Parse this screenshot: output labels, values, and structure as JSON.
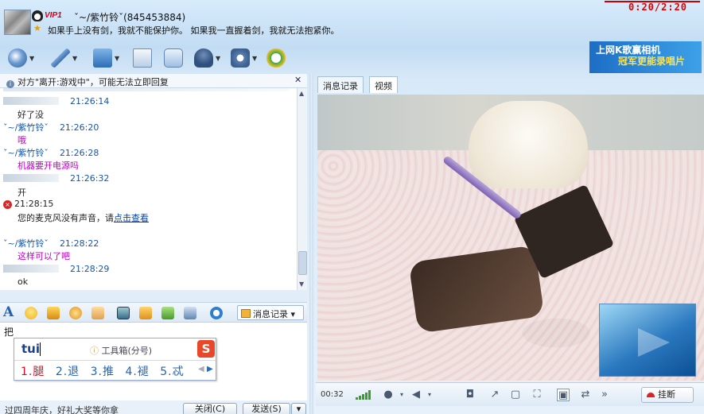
{
  "window": {
    "clock": "0:20/2:20",
    "contact_nick": "ˇ~/紫竹铃ˇ",
    "contact_id": "(845453884)",
    "vip_label": "VIP1",
    "status_message": "如果手上没有剑，我就不能保护你。 如果我一直握着剑，我就无法抱紧你。"
  },
  "toolbar": {
    "icons": [
      "video-call-icon",
      "voice-call-icon",
      "send-file-icon",
      "send-mail-icon",
      "app-icon",
      "remote-assist-icon",
      "settings-icon",
      "soso-icon"
    ]
  },
  "banner": {
    "line1": "上网K歌赢相机",
    "line2": "冠军更能录唱片"
  },
  "notice": {
    "text": "对方\"离开:游戏中\"，可能无法立即回复"
  },
  "chat": {
    "messages": [
      {
        "sender": "",
        "time": "21:26:14",
        "text": "好了没",
        "color": "#000000",
        "masked": true
      },
      {
        "sender": "ˇ~/紫竹铃ˇ",
        "time": "21:26:20",
        "text": "哦",
        "color": "#c000c8",
        "masked": false
      },
      {
        "sender": "ˇ~/紫竹铃ˇ",
        "time": "21:26:28",
        "text": "机器要开电源吗",
        "color": "#c000c8",
        "masked": false
      },
      {
        "sender": "",
        "time": "21:26:32",
        "text": "开",
        "color": "#000000",
        "masked": true
      }
    ],
    "system": {
      "time": "21:28:15",
      "text": "您的麦克风没有声音，请",
      "link": "点击查看"
    },
    "messages2": [
      {
        "sender": "ˇ~/紫竹铃ˇ",
        "time": "21:28:22",
        "text": "这样可以了吧",
        "color": "#c000c8",
        "masked": false
      },
      {
        "sender": "",
        "time": "21:28:29",
        "text": "ok",
        "color": "#000000",
        "masked": true
      }
    ]
  },
  "format_bar": {
    "history_label": "消息记录"
  },
  "input": {
    "typed_text": "把"
  },
  "ime": {
    "composition": "tui",
    "toolbox": "工具箱(分号)",
    "logo": "S",
    "candidates": [
      "1.腿",
      "2.退",
      "3.推",
      "4.褪",
      "5.忒"
    ]
  },
  "bottom": {
    "ticker": "过四周年庆，好礼大奖等你拿",
    "close_label": "关闭(C)",
    "send_label": "发送(S)"
  },
  "right": {
    "tabs": [
      "消息记录",
      "视频"
    ],
    "active_tab": 1,
    "call_time": "00:32",
    "hangup_label": "挂断"
  }
}
